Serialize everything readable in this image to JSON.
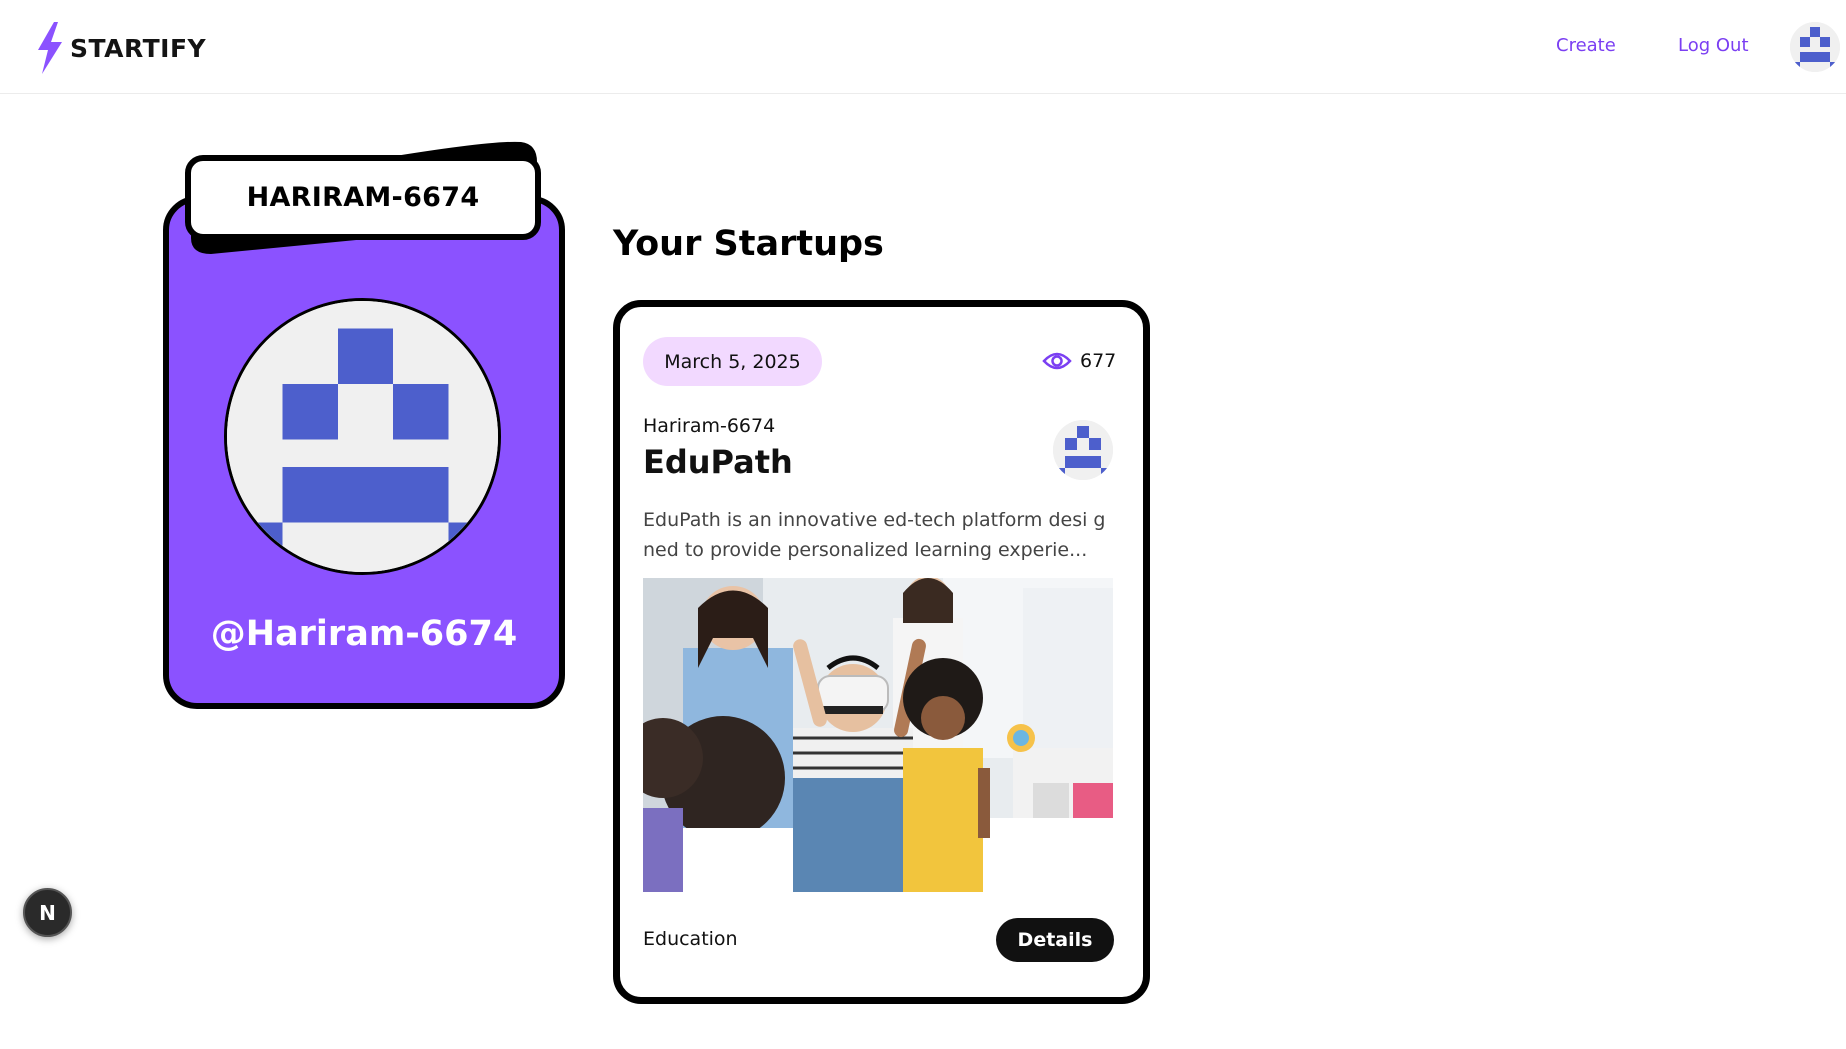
{
  "navbar": {
    "logo_text": "STARTIFY",
    "links": {
      "create": "Create",
      "logout": "Log Out"
    }
  },
  "profile": {
    "name_tag": "HARIRAM-6674",
    "handle": "@Hariram-6674",
    "avatar_icon": "identicon-avatar"
  },
  "main": {
    "section_title": "Your Startups"
  },
  "startup": {
    "date": "March 5, 2025",
    "views": "677",
    "author": "Hariram-6674",
    "title": "EduPath",
    "description": "EduPath is an innovative ed-tech platform desi gned to provide personalized learning experie...",
    "category": "Education",
    "details_label": "Details",
    "image_alt": "Children using VR headset in classroom"
  },
  "badge": {
    "label": "N"
  },
  "colors": {
    "accent": "#8b52ff",
    "link": "#7b3ff2",
    "pill": "#f2d9ff",
    "identicon": "#4d5fcc"
  }
}
